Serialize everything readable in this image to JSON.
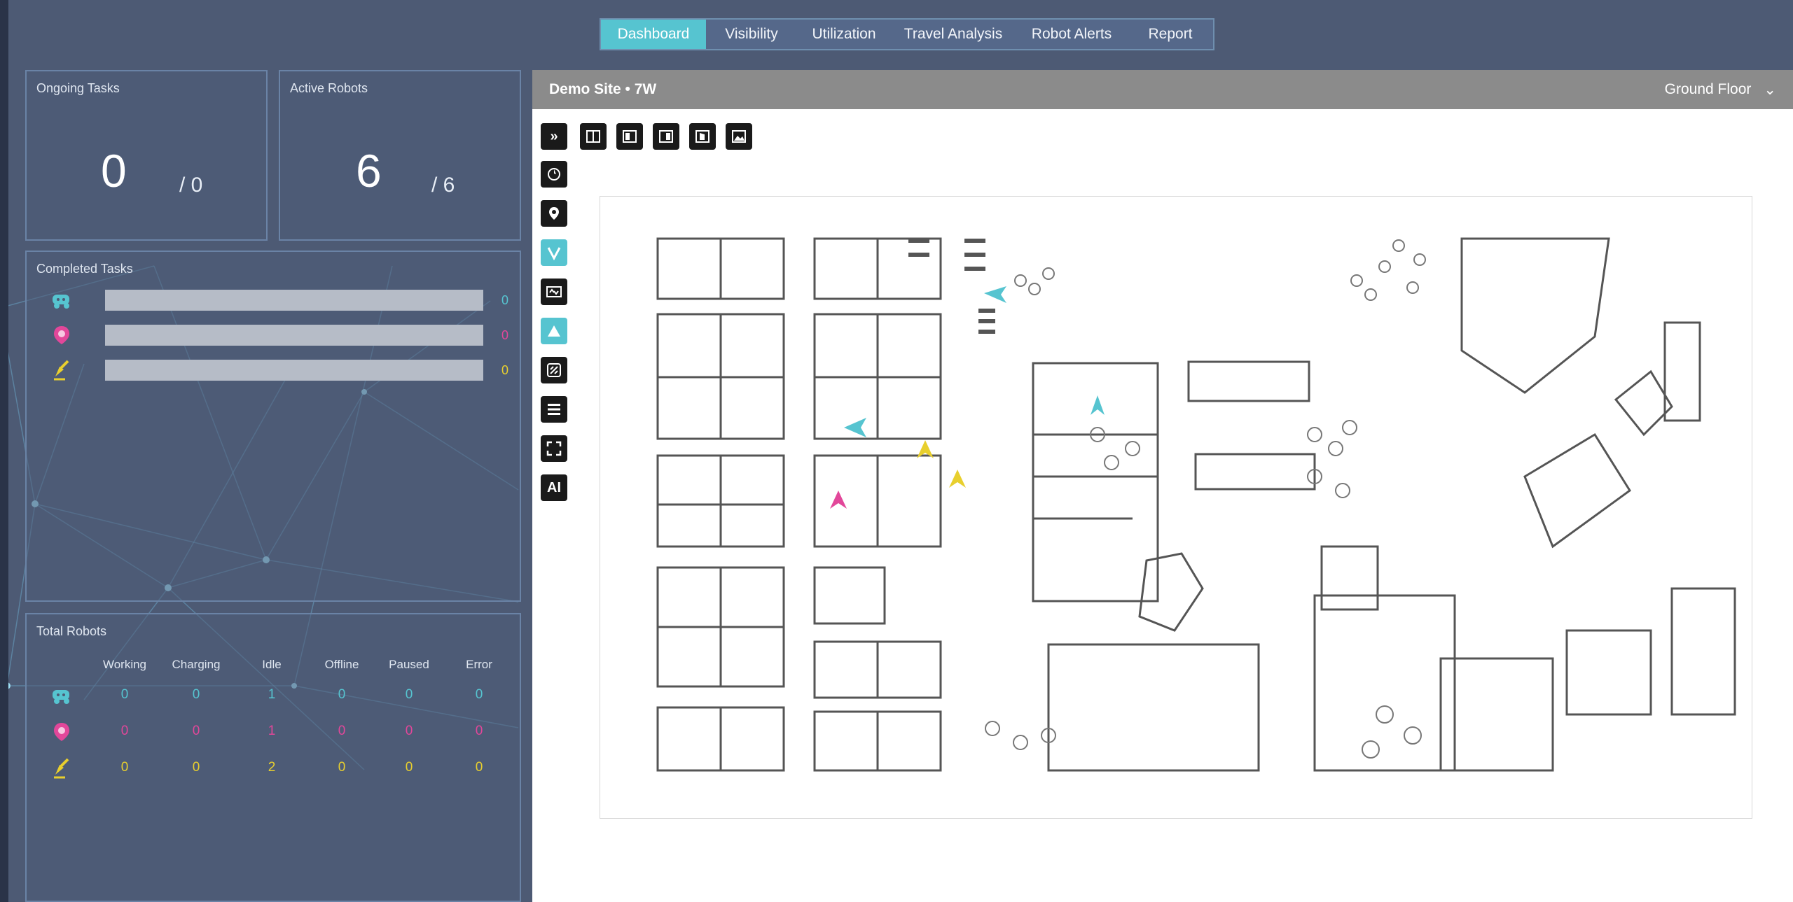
{
  "nav": {
    "tabs": [
      {
        "label": "Dashboard",
        "active": true
      },
      {
        "label": "Visibility",
        "active": false
      },
      {
        "label": "Utilization",
        "active": false
      },
      {
        "label": "Travel Analysis",
        "active": false
      },
      {
        "label": "Robot Alerts",
        "active": false
      },
      {
        "label": "Report",
        "active": false
      }
    ]
  },
  "ongoing_tasks": {
    "title": "Ongoing Tasks",
    "current": "0",
    "total": "/ 0"
  },
  "active_robots": {
    "title": "Active Robots",
    "current": "6",
    "total": "/ 6"
  },
  "completed_tasks": {
    "title": "Completed Tasks",
    "rows": [
      {
        "icon": "delivery-robot-icon",
        "value": "0",
        "fill": 0,
        "color": "#56c4d0"
      },
      {
        "icon": "disinfection-robot-icon",
        "value": "0",
        "fill": 0,
        "color": "#e2479a"
      },
      {
        "icon": "cleaning-robot-icon",
        "value": "0",
        "fill": 0,
        "color": "#e8cf2e"
      }
    ]
  },
  "total_robots": {
    "title": "Total Robots",
    "headers": [
      "Working",
      "Charging",
      "Idle",
      "Offline",
      "Paused",
      "Error"
    ],
    "rows": [
      {
        "icon": "delivery-robot-icon",
        "color": "#56c4d0",
        "values": [
          "0",
          "0",
          "1",
          "0",
          "0",
          "0"
        ]
      },
      {
        "icon": "disinfection-robot-icon",
        "color": "#e2479a",
        "values": [
          "0",
          "0",
          "1",
          "0",
          "0",
          "0"
        ]
      },
      {
        "icon": "cleaning-robot-icon",
        "color": "#e8cf2e",
        "values": [
          "0",
          "0",
          "2",
          "0",
          "0",
          "0"
        ]
      }
    ]
  },
  "map": {
    "title": "Demo Site • 7W",
    "floor": "Ground Floor",
    "tools_row": [
      "split-view-icon",
      "left-panel-icon",
      "right-panel-icon",
      "door-icon",
      "image-icon"
    ],
    "tools_col": [
      "collapse-icon",
      "compass-icon",
      "location-pin-icon",
      "robot-v-icon",
      "elevator-icon",
      "triangle-icon",
      "path-icon",
      "list-icon",
      "fullscreen-icon",
      "ai-icon"
    ],
    "ai_label": "AI"
  },
  "colors": {
    "accent": "#56c4d0",
    "magenta": "#e2479a",
    "yellow": "#e8cf2e"
  }
}
